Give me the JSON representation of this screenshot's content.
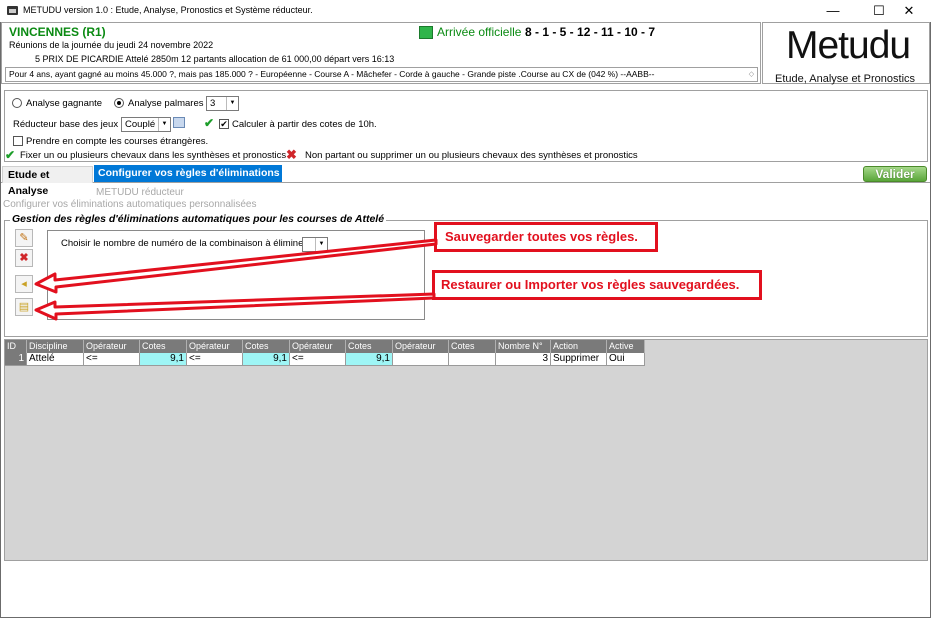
{
  "window": {
    "title": "METUDU version 1.0  : Etude, Analyse,  Pronostics et Système réducteur.",
    "minimize_glyph": "—",
    "maximize_glyph": "☐",
    "close_glyph": "✕"
  },
  "race": {
    "venue": "VINCENNES (R1)",
    "date_line": "Réunions de la journée du jeudi 24 novembre 2022",
    "race_line": "5 PRIX DE PICARDIE Attelé 2850m 12 partants allocation de 61 000,00 départ vers 16:13",
    "conditions": "Pour 4 ans, ayant gagné au moins 45.000 ?, mais pas 185.000 ? - Européenne - Course A - Mâchefer - Corde à gauche - Grande piste .Course au CX de (042 %)  --AABB--",
    "official_label": "Arrivée officielle :",
    "official_result": "8 - 1 - 5 - 12 - 11 - 10 - 7"
  },
  "logo": {
    "title": "Metudu",
    "subtitle": "Etude, Analyse et Pronostics"
  },
  "options": {
    "analyse_gagnante_label": "Analyse gagnante",
    "analyse_palmares_label": "Analyse palmares",
    "palmares_value": "3",
    "reducteur_label": "Réducteur base des jeux :",
    "reducteur_value": "Couplé",
    "calculer_label": "Calculer à partir des cotes de 10h.",
    "etrangeres_label": "Prendre en compte les courses étrangères.",
    "fixer_label": "Fixer un ou plusieurs chevaux dans les synthèses et pronostics",
    "non_partant_label": "Non partant ou supprimer un ou plusieurs chevaux des synthèses et pronostics"
  },
  "tabs": {
    "etude": "Etude et Analyse",
    "config": "Configurer vos règles d'éliminations",
    "valider": "Valider"
  },
  "section": {
    "subtitle1": "METUDU réducteur",
    "subtitle2": "Configurer vos éliminations automatiques personnalisées",
    "group_title": "Gestion des règles d'éliminations automatiques pour les courses de Attelé",
    "combi_label": "Choisir le nombre de numéro de la combinaison à éliminer :"
  },
  "grid": {
    "headers": [
      "ID",
      "Discipline",
      "Opérateur",
      "Cotes",
      "Opérateur",
      "Cotes",
      "Opérateur",
      "Cotes",
      "Opérateur",
      "Cotes",
      "Nombre N°",
      "Action",
      "Active"
    ],
    "rows": [
      [
        "1",
        "Attelé",
        "<=",
        "9,1",
        "<=",
        "9,1",
        "<=",
        "9,1",
        "",
        "",
        "3",
        "Supprimer",
        "Oui"
      ]
    ]
  },
  "callouts": {
    "save": "Sauvegarder toutes vos règles.",
    "restore": "Restaurer ou Importer vos règles sauvegardées."
  },
  "colors": {
    "accent_tab": "#0078d7",
    "venue_green": "#0a8a12",
    "callout_red": "#e2101e",
    "cotes_cyan": "#9ef5f5"
  }
}
